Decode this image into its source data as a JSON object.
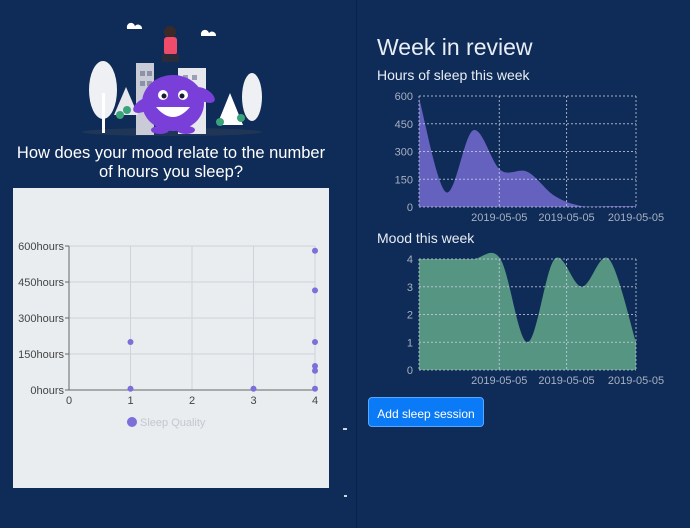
{
  "left": {
    "question": "How does your mood relate to the number of hours you sleep?"
  },
  "right": {
    "title": "Week in review",
    "sleep_chart_title": "Hours of sleep this week",
    "mood_chart_title": "Mood this week",
    "add_button": "Add sleep session"
  },
  "colors": {
    "background": "#0f2b57",
    "sleep_fill": "#6a64c4",
    "mood_fill": "#5b9b84",
    "scatter_point": "#7a70d8",
    "button": "#0b7af7"
  },
  "chart_data": [
    {
      "type": "scatter",
      "title": "",
      "xlabel": "",
      "ylabel": "",
      "x_ticks": [
        "0",
        "1",
        "2",
        "3",
        "4"
      ],
      "y_ticks": [
        "0hours",
        "150hours",
        "300hours",
        "450hours",
        "600hours"
      ],
      "xlim": [
        0,
        4
      ],
      "ylim": [
        0,
        600
      ],
      "grid": true,
      "legend": "bottom-center",
      "series": [
        {
          "name": "Sleep Quality",
          "points": [
            [
              1,
              200
            ],
            [
              1,
              5
            ],
            [
              3,
              5
            ],
            [
              4,
              580
            ],
            [
              4,
              415
            ],
            [
              4,
              200
            ],
            [
              4,
              100
            ],
            [
              4,
              80
            ],
            [
              4,
              5
            ]
          ]
        }
      ]
    },
    {
      "type": "area",
      "title": "Hours of sleep this week",
      "x_ticks": [
        "2019-05-05",
        "2019-05-05",
        "2019-05-05"
      ],
      "y_ticks": [
        "0",
        "150",
        "300",
        "450",
        "600"
      ],
      "ylim": [
        0,
        600
      ],
      "grid": true,
      "values": [
        590,
        80,
        415,
        200,
        190,
        60,
        5,
        5,
        5
      ]
    },
    {
      "type": "area",
      "title": "Mood this week",
      "x_ticks": [
        "2019-05-05",
        "2019-05-05",
        "2019-05-05"
      ],
      "y_ticks": [
        "0",
        "1",
        "2",
        "3",
        "4"
      ],
      "ylim": [
        0,
        4
      ],
      "grid": true,
      "values": [
        4,
        4,
        4,
        4,
        1,
        4,
        3,
        4,
        1
      ]
    }
  ]
}
